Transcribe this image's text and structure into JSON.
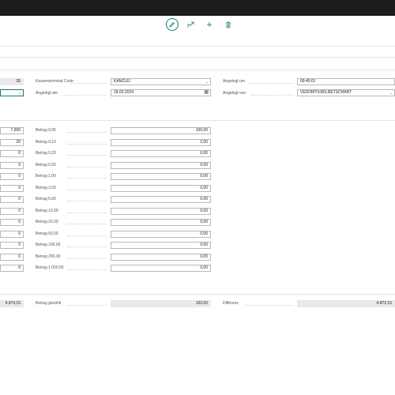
{
  "toolbar": {
    "edit_icon": "pencil-icon",
    "share_icon": "share-icon",
    "add_icon": "plus-icon",
    "delete_icon": "trash-icon"
  },
  "header": {
    "left_number": "35",
    "kassenterminal_label": "Kassenterminal Code",
    "kassenterminal_value": "KANZLEI",
    "angelegt_um_label": "Angelegt um",
    "angelegt_um_value": "09:45:01",
    "angelegt_am_label": "Angelegt am",
    "angelegt_am_value": "18.03.2024",
    "angelegt_von_label": "Angelegt von",
    "angelegt_von_value": "VEDOMY\\URS.BETSCHART"
  },
  "left_column_values": [
    "7,000",
    "20",
    "0",
    "0",
    "0",
    "0",
    "0",
    "0",
    "0",
    "0",
    "0",
    "0",
    "0"
  ],
  "betrag_rows": [
    {
      "label": "Betrag 0,05",
      "value": "100,00"
    },
    {
      "label": "Betrag 0,10",
      "value": "2,00"
    },
    {
      "label": "Betrag 0,20",
      "value": "0,00"
    },
    {
      "label": "Betrag 0,50",
      "value": "0,00"
    },
    {
      "label": "Betrag 1,00",
      "value": "0,00"
    },
    {
      "label": "Betrag 2,00",
      "value": "0,00"
    },
    {
      "label": "Betrag 5,00",
      "value": "0,00"
    },
    {
      "label": "Betrag 10,00",
      "value": "0,00"
    },
    {
      "label": "Betrag 20,00",
      "value": "0,00"
    },
    {
      "label": "Betrag 50,00",
      "value": "0,00"
    },
    {
      "label": "Betrag 100,00",
      "value": "0,00"
    },
    {
      "label": "Betrag 200,00",
      "value": "0,00"
    },
    {
      "label": "Betrag 1.000,00",
      "value": "0,00"
    }
  ],
  "totals": {
    "left_total": "4.974,15",
    "betrag_gezahlt_label": "Betrag gezählt",
    "betrag_gezahlt_value": "102,00",
    "differenz_label": "Differenz",
    "differenz_value": "4.872,15"
  }
}
